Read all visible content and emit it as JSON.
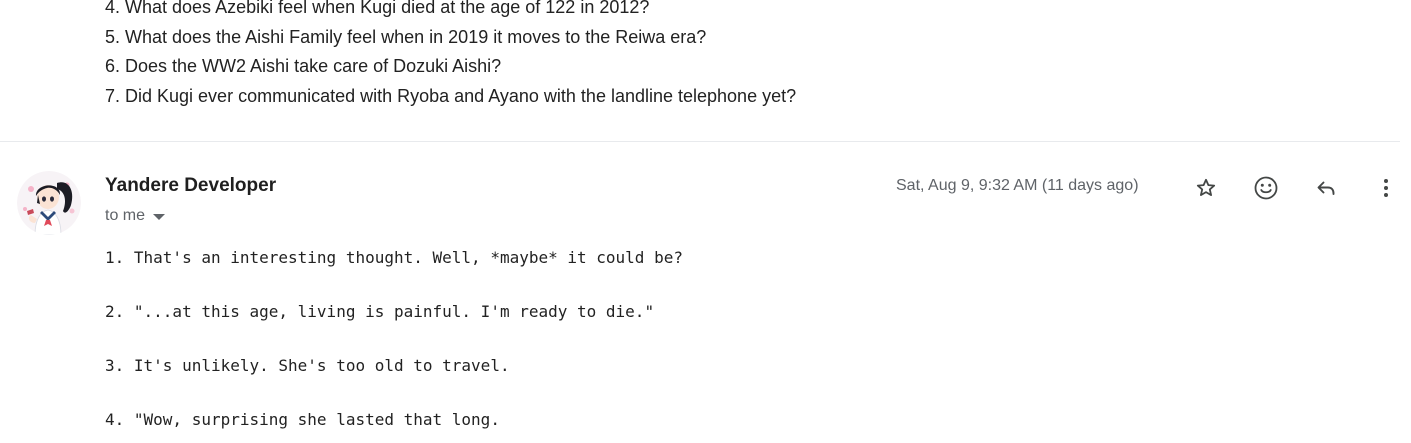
{
  "quoted_lines": [
    "4. What does Azebiki feel when Kugi died at the age of 122 in 2012?",
    "5. What does the Aishi Family feel when in 2019 it moves to the Reiwa era?",
    "6. Does the WW2 Aishi take care of Dozuki Aishi?",
    "7. Did Kugi ever communicated with Ryoba and Ayano with the landline telephone yet?"
  ],
  "message": {
    "sender": "Yandere Developer",
    "recipient": "to me",
    "date": "Sat, Aug 9, 9:32 AM (11 days ago)",
    "actions": [
      "star-icon",
      "emoji-icon",
      "reply-icon",
      "more-vert-icon"
    ],
    "body_lines": [
      "1. That's an interesting thought. Well, *maybe* it could be?",
      "2. \"...at this age, living is painful. I'm ready to die.\"",
      "3. It's unlikely. She's too old to travel.",
      "4. \"Wow, surprising she lasted that long."
    ]
  },
  "colors": {
    "icon": "#444746",
    "secondary_text": "#5f6368",
    "divider": "#e8eaed"
  }
}
